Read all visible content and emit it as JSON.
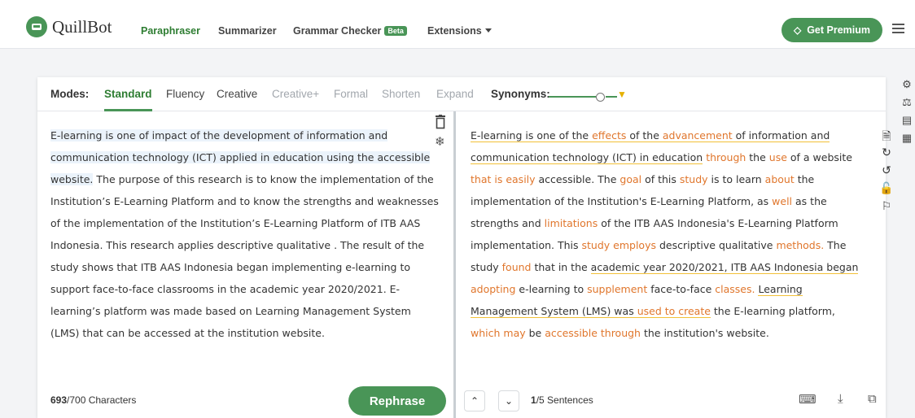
{
  "header": {
    "logo_text": "QuillBot",
    "nav": [
      {
        "label": "Paraphraser"
      },
      {
        "label": "Summarizer"
      },
      {
        "label": "Grammar Checker"
      },
      {
        "label": "Extensions"
      }
    ],
    "beta_badge": "Beta",
    "premium_label": "Get Premium"
  },
  "modes": {
    "label": "Modes:",
    "items": [
      "Standard",
      "Fluency",
      "Creative",
      "Creative+",
      "Formal",
      "Shorten",
      "Expand"
    ],
    "active": "Standard",
    "synonyms_label": "Synonyms:",
    "synonyms_level": 0.7
  },
  "input": {
    "text_highlighted": "E-learning is one of impact of the development of information and communication technology (ICT) applied in education using the accessible website.",
    "text_rest": " The purpose of this research is to know the implementation of the Institution’s E-Learning Platform and to know the strengths and weaknesses of the implementation of the Institution’s E-Learning Platform of ITB AAS Indonesia. This research applies descriptive qualitative . The result of the study shows that ITB AAS Indonesia began implementing e-learning to support face-to-face classrooms in the academic year 2020/2021. E-learning’s platform was made based on Learning Management System (LMS) that can be accessed at the institution website.",
    "char_count": "693",
    "char_limit": "/700 Characters",
    "rephrase_label": "Rephrase"
  },
  "output": {
    "segments": [
      {
        "t": "E-learning is one of the ",
        "c": "ul"
      },
      {
        "t": "effects",
        "c": "ch ul"
      },
      {
        "t": " of the ",
        "c": "ul"
      },
      {
        "t": "advancement",
        "c": "ch ul"
      },
      {
        "t": " of information and communication technology (ICT) in education",
        "c": "ul"
      },
      {
        "t": " ",
        "c": ""
      },
      {
        "t": "through",
        "c": "ch"
      },
      {
        "t": " the ",
        "c": ""
      },
      {
        "t": "use",
        "c": "ch"
      },
      {
        "t": " of a website ",
        "c": ""
      },
      {
        "t": "that is",
        "c": "ch"
      },
      {
        "t": " ",
        "c": ""
      },
      {
        "t": "easily",
        "c": "ch"
      },
      {
        "t": " accessible. The ",
        "c": ""
      },
      {
        "t": "goal",
        "c": "ch"
      },
      {
        "t": " of this ",
        "c": ""
      },
      {
        "t": "study",
        "c": "ch"
      },
      {
        "t": " is to learn ",
        "c": ""
      },
      {
        "t": "about",
        "c": "ch"
      },
      {
        "t": " the implementation of the Institution's E-Learning Platform, as ",
        "c": ""
      },
      {
        "t": "well",
        "c": "ch"
      },
      {
        "t": " as the strengths and ",
        "c": ""
      },
      {
        "t": "limitations",
        "c": "ch"
      },
      {
        "t": " of the ITB AAS Indonesia's E-Learning Platform implementation. This ",
        "c": ""
      },
      {
        "t": "study employs",
        "c": "ch"
      },
      {
        "t": " descriptive qualitative ",
        "c": ""
      },
      {
        "t": "methods.",
        "c": "ch"
      },
      {
        "t": " The study ",
        "c": ""
      },
      {
        "t": "found",
        "c": "ch"
      },
      {
        "t": " that in the ",
        "c": ""
      },
      {
        "t": "academic year 2020/2021, ITB AAS Indonesia began",
        "c": "ul"
      },
      {
        "t": " ",
        "c": ""
      },
      {
        "t": "adopting",
        "c": "ch"
      },
      {
        "t": " e-learning to ",
        "c": ""
      },
      {
        "t": "supplement",
        "c": "ch"
      },
      {
        "t": " face-to-face ",
        "c": ""
      },
      {
        "t": "classes.",
        "c": "ch"
      },
      {
        "t": " ",
        "c": ""
      },
      {
        "t": "Learning Management System (LMS) was ",
        "c": "ul"
      },
      {
        "t": "used to create",
        "c": "ch ul"
      },
      {
        "t": " the E-learning platform, ",
        "c": ""
      },
      {
        "t": "which may",
        "c": "ch"
      },
      {
        "t": " be ",
        "c": ""
      },
      {
        "t": "accessible through",
        "c": "ch"
      },
      {
        "t": " the institution's website.",
        "c": ""
      }
    ],
    "sentence_current": "1",
    "sentence_total": "/5 Sentences"
  },
  "colors": {
    "brand_green": "#499557",
    "changed_word": "#e0762c",
    "structure_underline": "#f2c037",
    "input_highlight": "#ebf3fb"
  },
  "icons": [
    "trash-icon",
    "freeze-icon",
    "file-icon",
    "refresh-icon",
    "undo-icon",
    "unlock-icon",
    "flag-icon",
    "keyboard-icon",
    "download-icon",
    "copy-icon",
    "settings-icon",
    "compare-icon",
    "comment-icon",
    "stats-icon",
    "gem-icon"
  ]
}
